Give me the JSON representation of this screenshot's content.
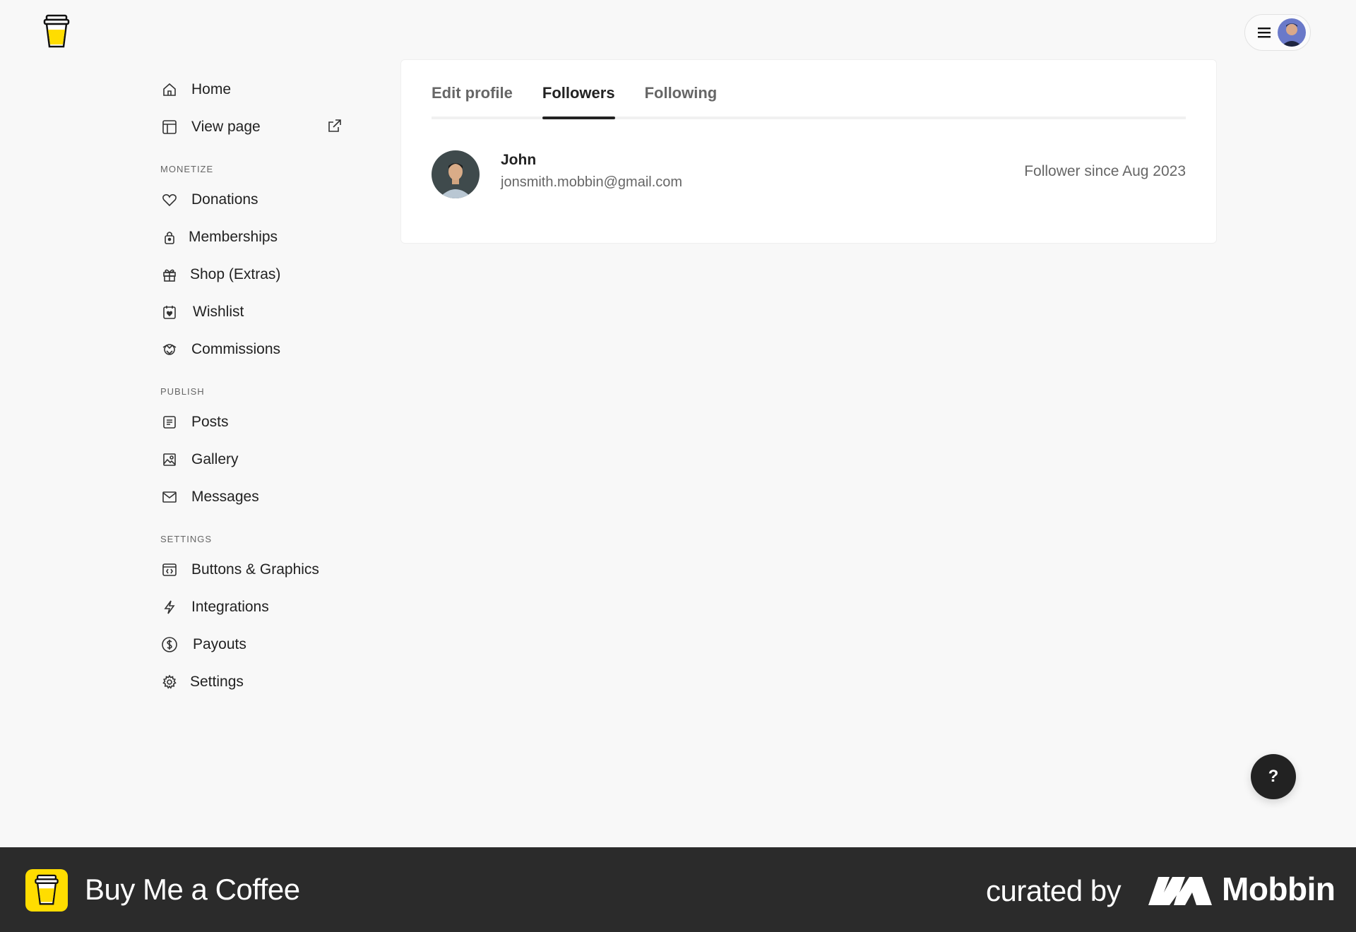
{
  "app": {
    "logo_icon": "cup-icon"
  },
  "sidebar": {
    "top_items": [
      {
        "label": "Home",
        "icon": "home-icon"
      },
      {
        "label": "View page",
        "icon": "layout-icon",
        "trailing_icon": "external-link-icon"
      }
    ],
    "sections": [
      {
        "label": "MONETIZE",
        "items": [
          {
            "label": "Donations",
            "icon": "heart-icon"
          },
          {
            "label": "Memberships",
            "icon": "lock-icon"
          },
          {
            "label": "Shop (Extras)",
            "icon": "gift-icon"
          },
          {
            "label": "Wishlist",
            "icon": "wishlist-icon"
          },
          {
            "label": "Commissions",
            "icon": "handshake-icon"
          }
        ]
      },
      {
        "label": "PUBLISH",
        "items": [
          {
            "label": "Posts",
            "icon": "document-icon"
          },
          {
            "label": "Gallery",
            "icon": "image-icon"
          },
          {
            "label": "Messages",
            "icon": "mail-icon"
          }
        ]
      },
      {
        "label": "SETTINGS",
        "items": [
          {
            "label": "Buttons & Graphics",
            "icon": "code-window-icon"
          },
          {
            "label": "Integrations",
            "icon": "lightning-icon"
          },
          {
            "label": "Payouts",
            "icon": "dollar-circle-icon"
          },
          {
            "label": "Settings",
            "icon": "gear-icon"
          }
        ]
      }
    ]
  },
  "main": {
    "tabs": [
      {
        "label": "Edit profile",
        "active": false
      },
      {
        "label": "Followers",
        "active": true
      },
      {
        "label": "Following",
        "active": false
      }
    ],
    "followers": [
      {
        "name": "John",
        "email": "jonsmith.mobbin@gmail.com",
        "since": "Follower since Aug 2023"
      }
    ]
  },
  "help_button": {
    "label": "?"
  },
  "footer": {
    "brand": "Buy Me a Coffee",
    "curated_by": "curated by",
    "mobbin": "Mobbin"
  }
}
